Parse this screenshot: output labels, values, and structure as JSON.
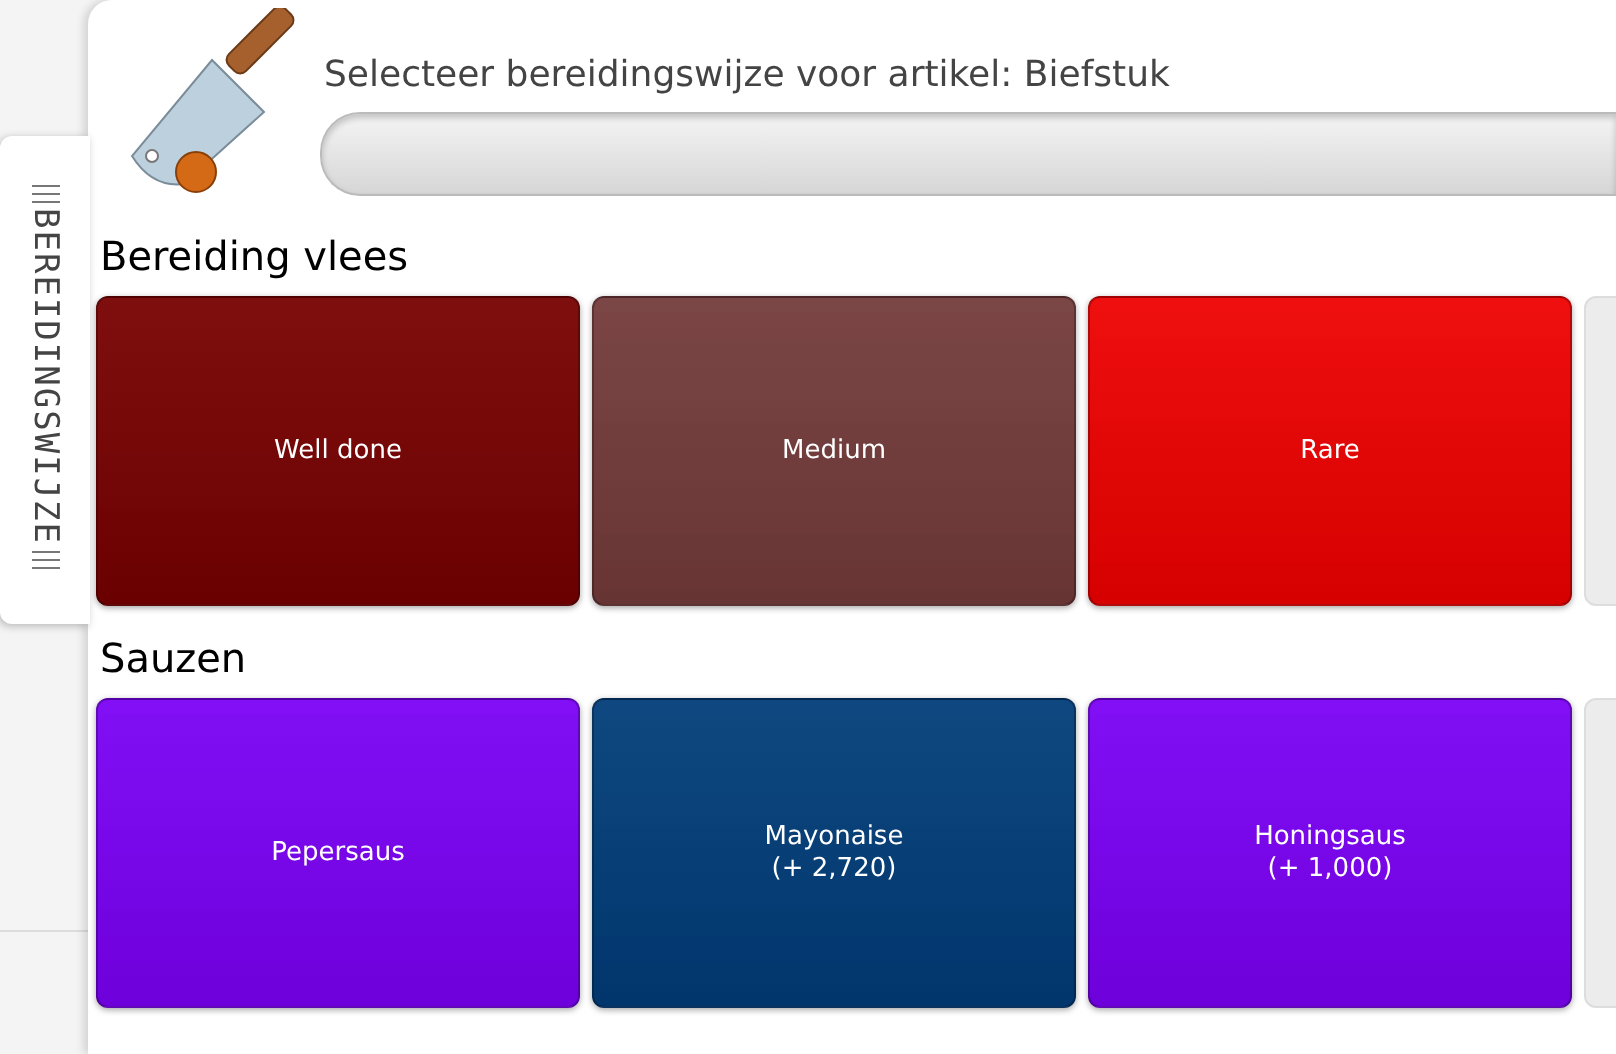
{
  "side_tab": {
    "label": "BEREIDINGSWIJZE",
    "selected": true
  },
  "dialog": {
    "title": "Selecteer bereidingswijze voor artikel: Biefstuk"
  },
  "sections": [
    {
      "title": "Bereiding vlees",
      "options": [
        {
          "label": "Well done",
          "color": "#770000"
        },
        {
          "label": "Medium",
          "color": "#733a3a"
        },
        {
          "label": "Rare",
          "color": "#ee0000"
        }
      ]
    },
    {
      "title": "Sauzen",
      "options": [
        {
          "label": "Pepersaus",
          "color": "#7a00f4"
        },
        {
          "label": "Mayonaise\n(+ 2,720)",
          "color": "#003c78"
        },
        {
          "label": "Honingsaus\n(+ 1,000)",
          "color": "#7a00f4"
        }
      ]
    }
  ]
}
